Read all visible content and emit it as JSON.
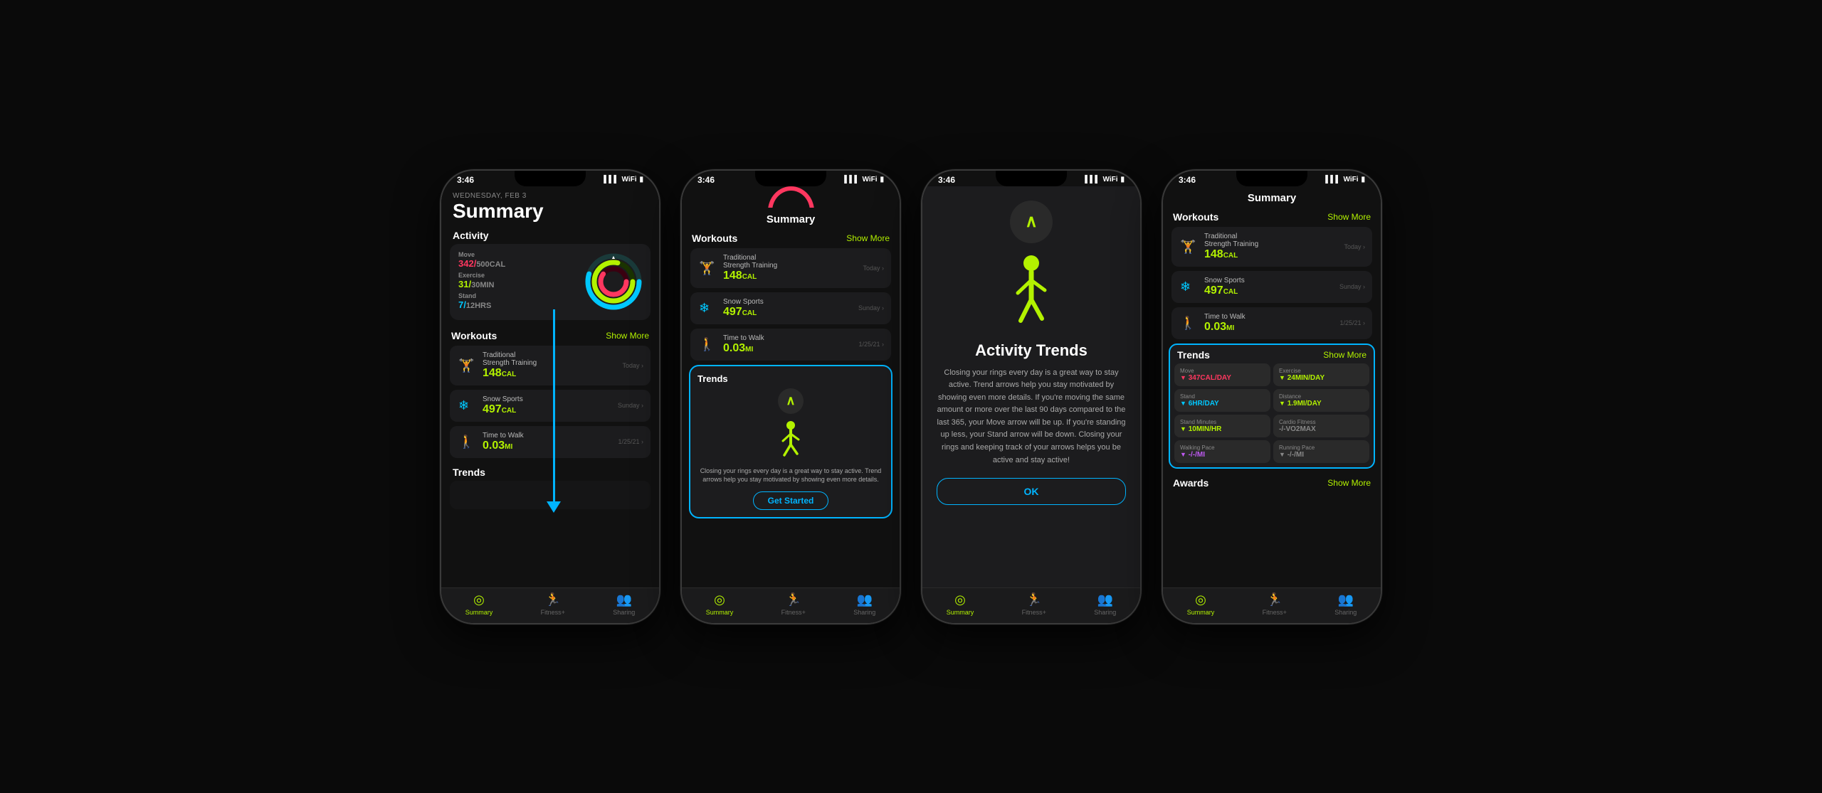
{
  "phones": [
    {
      "id": "phone1",
      "statusBar": {
        "time": "3:46",
        "signal": "▌▌▌",
        "wifi": "WiFi",
        "battery": "🔋"
      },
      "header": {
        "date": "WEDNESDAY, FEB 3",
        "title": "Summary"
      },
      "activity": {
        "sectionLabel": "Activity",
        "move": {
          "label": "Move",
          "value": "342/500",
          "unit": "CAL"
        },
        "exercise": {
          "label": "Exercise",
          "value": "31/30",
          "unit": "MIN"
        },
        "stand": {
          "label": "Stand",
          "value": "7/12",
          "unit": "HRS"
        }
      },
      "workoutsSectionLabel": "Workouts",
      "showMore": "Show More",
      "workouts": [
        {
          "name": "Traditional\nStrength Training",
          "cal": "148",
          "unit": "CAL",
          "date": "Today ›",
          "iconColor": "#b3f200"
        },
        {
          "name": "Snow Sports",
          "cal": "497",
          "unit": "CAL",
          "date": "Sunday ›",
          "iconColor": "#00c8ff"
        },
        {
          "name": "Time to Walk",
          "cal": "0.03",
          "unit": "MI",
          "date": "1/25/21 ›",
          "iconColor": "#b3f200"
        }
      ],
      "trendsSectionLabel": "Trends"
    },
    {
      "id": "phone2",
      "statusBar": {
        "time": "3:46",
        "signal": "▌▌▌",
        "wifi": "WiFi",
        "battery": "🔋"
      },
      "screenTitle": "Summary",
      "workoutsSectionLabel": "Workouts",
      "showMore": "Show More",
      "workouts": [
        {
          "name": "Traditional\nStrength Training",
          "cal": "148",
          "unit": "CAL",
          "date": "Today ›",
          "iconColor": "#b3f200"
        },
        {
          "name": "Snow Sports",
          "cal": "497",
          "unit": "CAL",
          "date": "Sunday ›",
          "iconColor": "#00c8ff"
        },
        {
          "name": "Time to Walk",
          "cal": "0.03",
          "unit": "MI",
          "date": "1/25/21 ›",
          "iconColor": "#b3f200"
        }
      ],
      "trendsSectionLabel": "Trends",
      "trendsText": "Closing your rings every day is a great way to stay active. Trend arrows help you stay motivated by showing even more details.",
      "getStarted": "Get Started"
    },
    {
      "id": "phone3",
      "statusBar": {
        "time": "3:46",
        "signal": "▌▌▌",
        "wifi": "WiFi",
        "battery": "🔋"
      },
      "modal": {
        "title": "Activity Trends",
        "text": "Closing your rings every day is a great way to stay active. Trend arrows help you stay motivated by showing even more details. If you're moving the same amount or more over the last 90 days compared to the last 365, your Move arrow will be up. If you're standing up less, your Stand arrow will be down. Closing your rings and keeping track of your arrows helps you be active and stay active!",
        "okLabel": "OK"
      }
    },
    {
      "id": "phone4",
      "statusBar": {
        "time": "3:46",
        "signal": "▌▌▌",
        "wifi": "WiFi",
        "battery": "🔋"
      },
      "screenTitle": "Summary",
      "workoutsSectionLabel": "Workouts",
      "showMore": "Show More",
      "workouts": [
        {
          "name": "Traditional\nStrength Training",
          "cal": "148",
          "unit": "CAL",
          "date": "Today ›",
          "iconColor": "#b3f200"
        },
        {
          "name": "Snow Sports",
          "cal": "497",
          "unit": "CAL",
          "date": "Sunday ›",
          "iconColor": "#00c8ff"
        },
        {
          "name": "Time to Walk",
          "cal": "0.03",
          "unit": "MI",
          "date": "1/25/21 ›",
          "iconColor": "#b3f200"
        }
      ],
      "trendsSectionLabel": "Trends",
      "trendsShowMore": "Show More",
      "trendMetrics": [
        {
          "label": "Move",
          "value": "347CAL/DAY",
          "color": "#ff375f",
          "arrow": "▼"
        },
        {
          "label": "Exercise",
          "value": "24MIN/DAY",
          "color": "#b3f200",
          "arrow": "▼"
        },
        {
          "label": "Stand",
          "value": "6HR/DAY",
          "color": "#00c8ff",
          "arrow": "▼"
        },
        {
          "label": "Distance",
          "value": "1.9MI/DAY",
          "color": "#b3f200",
          "arrow": "▼"
        },
        {
          "label": "Stand Minutes",
          "value": "10MIN/HR",
          "color": "#b3f200",
          "arrow": "▼"
        },
        {
          "label": "Cardio Fitness",
          "value": "-/-VO2MAX",
          "color": "#888",
          "arrow": ""
        },
        {
          "label": "Walking Pace",
          "value": "-/-/MI",
          "color": "#bf5af2",
          "arrow": "▼"
        },
        {
          "label": "Running Pace",
          "value": "-/-/MI",
          "color": "#888",
          "arrow": "▼"
        }
      ],
      "awardsSectionLabel": "Awards",
      "awardsShowMore": "Show More"
    }
  ],
  "tabBar": {
    "items": [
      {
        "label": "Summary",
        "active": true
      },
      {
        "label": "Fitness+",
        "active": false
      },
      {
        "label": "Sharing",
        "active": false
      }
    ]
  }
}
